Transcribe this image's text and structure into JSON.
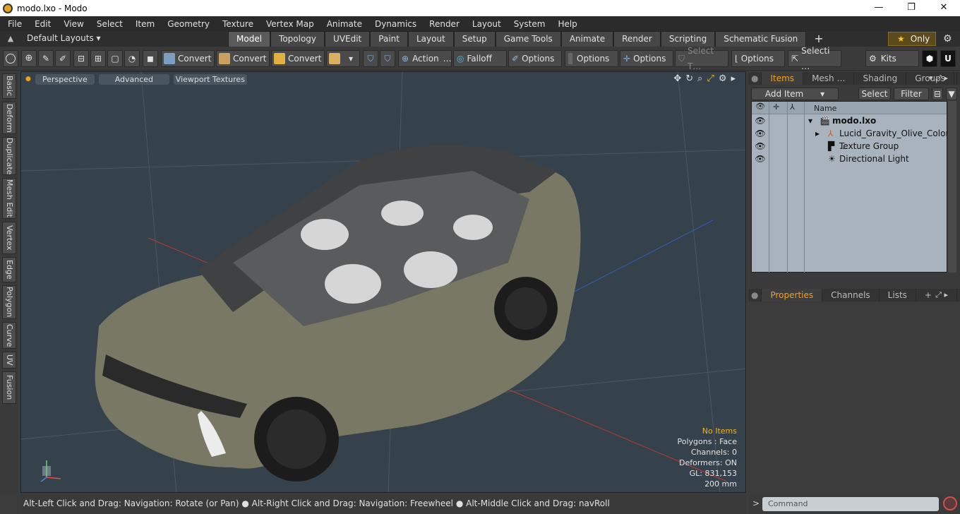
{
  "window": {
    "title": "modo.lxo - Modo",
    "minimize": "—",
    "maximize": "❐",
    "close": "✕"
  },
  "menu": [
    "File",
    "Edit",
    "View",
    "Select",
    "Item",
    "Geometry",
    "Texture",
    "Vertex Map",
    "Animate",
    "Dynamics",
    "Render",
    "Layout",
    "System",
    "Help"
  ],
  "layouts": {
    "label": "Default Layouts ▾"
  },
  "tabs": [
    "Model",
    "Topology",
    "UVEdit",
    "Paint",
    "Layout",
    "Setup",
    "Game Tools",
    "Animate",
    "Render",
    "Scripting",
    "Schematic Fusion"
  ],
  "active_tab": "Model",
  "only": {
    "label": "Only"
  },
  "toolbar": {
    "convert1": "Convert",
    "convert2": "Convert",
    "convert3": "Convert",
    "action": "Action",
    "action_more": "…",
    "falloff": "Falloff",
    "options1": "Options",
    "options2": "Options",
    "options3": "Options",
    "options4": "Options",
    "select_t": "Select T…",
    "selecti": "Selecti …",
    "kits": "Kits"
  },
  "left_tabs": [
    "Basic",
    "Deform",
    "Duplicate",
    "Mesh Edit",
    "Vertex",
    "Edge",
    "Polygon",
    "Curve",
    "UV",
    "Fusion"
  ],
  "viewport": {
    "tabs": [
      "Perspective",
      "Advanced",
      "Viewport Textures"
    ],
    "info": {
      "no_items": "No Items",
      "polygons": "Polygons : Face",
      "channels": "Channels: 0",
      "deformers": "Deformers: ON",
      "gl": "GL: 831,153",
      "scale": "200 mm"
    }
  },
  "items_panel": {
    "tabs": [
      "Items",
      "Mesh …",
      "Shading",
      "Groups"
    ],
    "add_item": "Add Item",
    "select": "Select",
    "filter": "Filter",
    "column_name": "Name",
    "rows": [
      {
        "label": "modo.lxo",
        "bold": true
      },
      {
        "label": "Lucid_Gravity_Olive_Colore …"
      },
      {
        "label": "Texture Group"
      },
      {
        "label": "Directional Light"
      }
    ]
  },
  "properties_panel": {
    "tabs": [
      "Properties",
      "Channels",
      "Lists"
    ]
  },
  "status": {
    "text": "Alt-Left Click and Drag: Navigation: Rotate (or Pan) ● Alt-Right Click and Drag: Navigation: Freewheel ● Alt-Middle Click and Drag: navRoll"
  },
  "command": {
    "placeholder": "Command"
  }
}
